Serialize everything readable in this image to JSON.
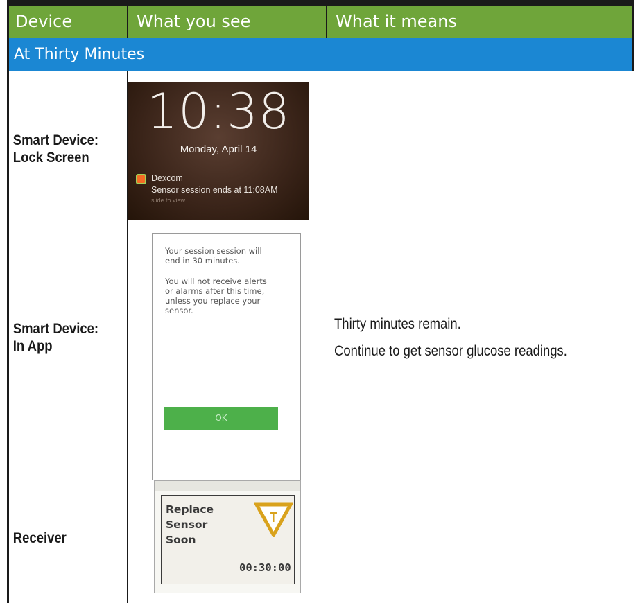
{
  "header": {
    "col1": "Device",
    "col2": "What you see",
    "col3": "What it means"
  },
  "section": "At Thirty Minutes",
  "rows": [
    {
      "device": "Smart Device: Lock Screen",
      "device_line1": "Smart Device:",
      "device_line2": "Lock Screen"
    },
    {
      "device": "Smart Device: In App",
      "device_line1": "Smart Device:",
      "device_line2": "In App"
    },
    {
      "device": "Receiver",
      "device_line1": "Receiver",
      "device_line2": ""
    }
  ],
  "lock_screen": {
    "time": "10:38",
    "date": "Monday, April 14",
    "app_name": "Dexcom",
    "message": "Sensor session ends at 11:08AM",
    "slide": "slide to view"
  },
  "in_app": {
    "para1_l1": "Your session session will",
    "para1_l2": "end in 30 minutes.",
    "para2_l1": "You will not receive alerts",
    "para2_l2": "or alarms after this time,",
    "para2_l3": "unless you replace your",
    "para2_l4": "sensor.",
    "ok": "OK"
  },
  "receiver": {
    "line1": "Replace",
    "line2": "Sensor",
    "line3": "Soon",
    "timer": "00:30:00"
  },
  "meaning": {
    "line1": "Thirty minutes remain.",
    "line2": "Continue to get sensor glucose readings."
  },
  "colors": {
    "header_green": "#6fa53a",
    "section_blue": "#1b87d3",
    "ok_green": "#4db04a",
    "warning_yellow": "#d9a21c"
  }
}
